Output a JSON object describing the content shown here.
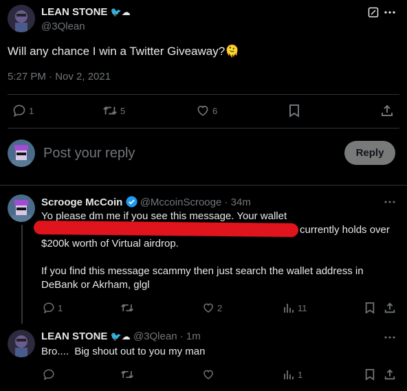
{
  "main_tweet": {
    "display_name": "LEAN STONE",
    "handle": "@3Qlean",
    "text": "Will any chance I win a Twitter Giveaway?",
    "emoji": "🫠",
    "timestamp": "5:27 PM · Nov 2, 2021",
    "replies": "1",
    "retweets": "5",
    "likes": "6"
  },
  "composer": {
    "placeholder": "Post your reply",
    "button_label": "Reply"
  },
  "reply1": {
    "display_name": "Scrooge McCoin",
    "handle": "@MccoinScrooge",
    "time": "· 34m",
    "line1": "Yo please dm me if you see this message. Your wallet",
    "line2_tail": "currently holds over",
    "line3": "$200k worth of Virtual airdrop.",
    "line4": "If you find this message scammy then just search the wallet address in",
    "line5": "DeBank or Akrham, glgl",
    "replies": "1",
    "likes": "2",
    "views": "11"
  },
  "reply2": {
    "display_name": "LEAN STONE",
    "handle": "@3Qlean",
    "time": "· 1m",
    "text": "Bro....  Big shout out to you my man",
    "views": "1"
  },
  "colors": {
    "background": "#000000",
    "text": "#e7e9ea",
    "muted": "#71767b",
    "verified": "#1d9bf0",
    "redaction": "#e0141c"
  }
}
